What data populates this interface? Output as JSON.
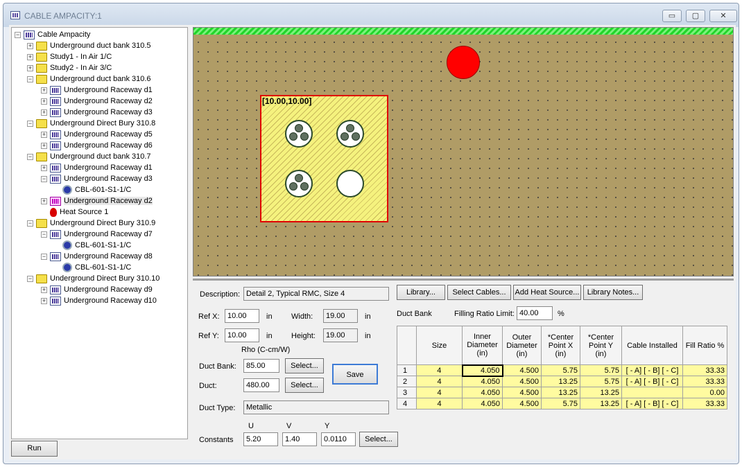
{
  "window": {
    "title": "CABLE AMPACITY:1",
    "min": "▭",
    "max": "▢",
    "close": "✕"
  },
  "tree": {
    "root": "Cable Ampacity",
    "items": [
      {
        "label": "Underground duct bank 310.5",
        "icon": "folder",
        "level": 1,
        "expander": "+"
      },
      {
        "label": "Study1 - In Air 1/C",
        "icon": "folder",
        "level": 1,
        "expander": "+"
      },
      {
        "label": "Study2 - In Air 3/C",
        "icon": "folder",
        "level": 1,
        "expander": "+"
      },
      {
        "label": "Underground duct bank 310.6",
        "icon": "folder",
        "level": 1,
        "expander": "−"
      },
      {
        "label": "Underground Raceway d1",
        "icon": "raceway",
        "level": 2,
        "expander": "+"
      },
      {
        "label": "Underground Raceway d2",
        "icon": "raceway",
        "level": 2,
        "expander": "+"
      },
      {
        "label": "Underground Raceway d3",
        "icon": "raceway",
        "level": 2,
        "expander": "+"
      },
      {
        "label": "Underground Direct Bury 310.8",
        "icon": "folder",
        "level": 1,
        "expander": "−"
      },
      {
        "label": "Underground Raceway d5",
        "icon": "raceway",
        "level": 2,
        "expander": "+"
      },
      {
        "label": "Underground Raceway d6",
        "icon": "raceway",
        "level": 2,
        "expander": "+"
      },
      {
        "label": "Underground duct bank 310.7",
        "icon": "folder",
        "level": 1,
        "expander": "−"
      },
      {
        "label": "Underground Raceway d1",
        "icon": "raceway",
        "level": 2,
        "expander": "+"
      },
      {
        "label": "Underground Raceway d3",
        "icon": "raceway",
        "level": 2,
        "expander": "−"
      },
      {
        "label": "CBL-601-S1-1/C",
        "icon": "cable",
        "level": 3,
        "expander": ""
      },
      {
        "label": "Underground Raceway d2",
        "icon": "raceway-selected",
        "level": 2,
        "expander": "+"
      },
      {
        "label": "Heat Source 1",
        "icon": "heat",
        "level": 2,
        "expander": ""
      },
      {
        "label": "Underground Direct Bury 310.9",
        "icon": "folder",
        "level": 1,
        "expander": "−"
      },
      {
        "label": "Underground Raceway d7",
        "icon": "raceway",
        "level": 2,
        "expander": "−"
      },
      {
        "label": "CBL-601-S1-1/C",
        "icon": "cable",
        "level": 3,
        "expander": ""
      },
      {
        "label": "Underground Raceway d8",
        "icon": "raceway",
        "level": 2,
        "expander": "−"
      },
      {
        "label": "CBL-601-S1-1/C",
        "icon": "cable",
        "level": 3,
        "expander": ""
      },
      {
        "label": "Underground Direct Bury 310.10",
        "icon": "folder",
        "level": 1,
        "expander": "−"
      },
      {
        "label": "Underground Raceway d9",
        "icon": "raceway",
        "level": 2,
        "expander": "+"
      },
      {
        "label": "Underground Raceway d10",
        "icon": "raceway",
        "level": 2,
        "expander": "+"
      }
    ]
  },
  "run_label": "Run",
  "canvas": {
    "bank_label": "[10.00,10.00]",
    "ducts": [
      {
        "conductors": 3
      },
      {
        "conductors": 3
      },
      {
        "conductors": 3
      },
      {
        "conductors": 0
      }
    ]
  },
  "props": {
    "description_label": "Description:",
    "description": "Detail 2, Typical RMC, Size 4",
    "ref_x_label": "Ref X:",
    "ref_x": "10.00",
    "ref_y_label": "Ref Y:",
    "ref_y": "10.00",
    "unit_in": "in",
    "width_label": "Width:",
    "width": "19.00",
    "height_label": "Height:",
    "height": "19.00",
    "rho_label": "Rho (C-cm/W)",
    "duct_bank_label": "Duct Bank:",
    "duct_bank": "85.00",
    "duct_label": "Duct:",
    "duct": "480.00",
    "select_label": "Select...",
    "save_label": "Save",
    "duct_type_label": "Duct Type:",
    "duct_type": "Metallic",
    "u_label": "U",
    "v_label": "V",
    "y_label": "Y",
    "constants_label": "Constants",
    "u": "5.20",
    "v": "1.40",
    "y": "0.0110",
    "library_label": "Library...",
    "select_cables_label": "Select Cables...",
    "add_heat_label": "Add Heat Source...",
    "library_notes_label": "Library Notes...",
    "duct_bank_heading": "Duct Bank",
    "fill_limit_label": "Filling Ratio Limit:",
    "fill_limit": "40.00",
    "pct": "%"
  },
  "table": {
    "headers": [
      "Size",
      "Inner Diameter (in)",
      "Outer Diameter (in)",
      "*Center Point X (in)",
      "*Center Point Y (in)",
      "Cable Installed",
      "Fill Ratio %"
    ],
    "rows": [
      [
        "1",
        "4",
        "4.050",
        "4.500",
        "5.75",
        "5.75",
        "[ - A] [ - B] [ - C]",
        "33.33"
      ],
      [
        "2",
        "4",
        "4.050",
        "4.500",
        "13.25",
        "5.75",
        "[ - A] [ - B] [ - C]",
        "33.33"
      ],
      [
        "3",
        "4",
        "4.050",
        "4.500",
        "13.25",
        "13.25",
        "",
        "0.00"
      ],
      [
        "4",
        "4",
        "4.050",
        "4.500",
        "5.75",
        "13.25",
        "[ - A] [ - B] [ - C]",
        "33.33"
      ]
    ]
  }
}
